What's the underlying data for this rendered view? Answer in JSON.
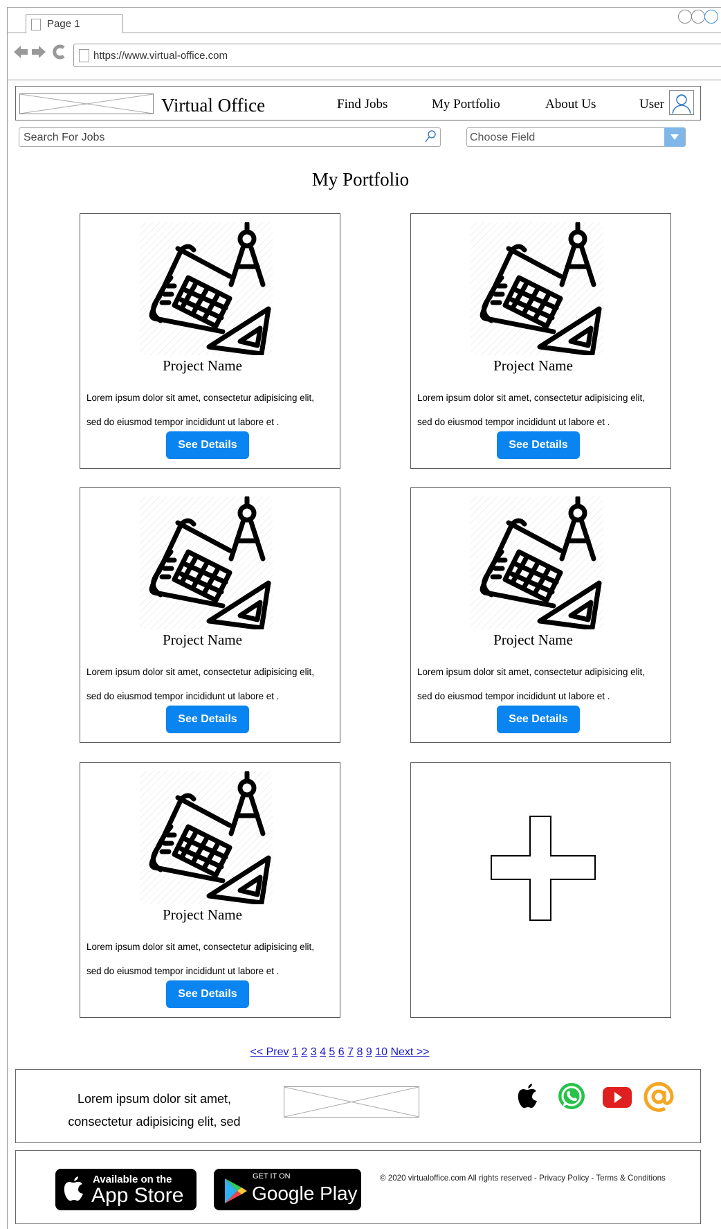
{
  "browser": {
    "tab_label": "Page 1",
    "url": "https://www.virtual-office.com"
  },
  "header": {
    "brand": "Virtual Office",
    "nav": [
      "Find Jobs",
      "My Portfolio",
      "About Us"
    ],
    "user_label": "User"
  },
  "search": {
    "placeholder": "Search For Jobs",
    "field_select": "Choose Field"
  },
  "page": {
    "title": "My Portfolio"
  },
  "projects": [
    {
      "name": "Project Name",
      "desc1": "Lorem ipsum dolor sit amet, consectetur adipisicing elit,",
      "desc2": "sed do eiusmod tempor incididunt ut labore et .",
      "button": "See Details"
    },
    {
      "name": "Project Name",
      "desc1": "Lorem ipsum dolor sit amet, consectetur adipisicing elit,",
      "desc2": "sed do eiusmod tempor incididunt ut labore et .",
      "button": "See Details"
    },
    {
      "name": "Project Name",
      "desc1": "Lorem ipsum dolor sit amet, consectetur adipisicing elit,",
      "desc2": "sed do eiusmod tempor incididunt ut labore et .",
      "button": "See Details"
    },
    {
      "name": "Project Name",
      "desc1": "Lorem ipsum dolor sit amet, consectetur adipisicing elit,",
      "desc2": "sed do eiusmod tempor incididunt ut labore et .",
      "button": "See Details"
    },
    {
      "name": "Project Name",
      "desc1": "Lorem ipsum dolor sit amet, consectetur adipisicing elit,",
      "desc2": "sed do eiusmod tempor incididunt ut labore et .",
      "button": "See Details"
    }
  ],
  "add_card_icon": "plus-icon",
  "pagination": {
    "prev": "<< Prev",
    "pages": [
      "1",
      "2",
      "3",
      "4",
      "5",
      "6",
      "7",
      "8",
      "9",
      "10"
    ],
    "next": "Next >>"
  },
  "footer": {
    "text1": "Lorem ipsum dolor sit amet,",
    "text2": "consectetur adipisicing elit, sed",
    "social_icons": [
      "apple-icon",
      "whatsapp-icon",
      "youtube-icon",
      "email-at-icon"
    ],
    "app_store_small": "Available on the",
    "app_store_big": "App Store",
    "google_play_small": "GET IT ON",
    "google_play_big": "Google Play",
    "copyright": "© 2020 virtualoffice.com All rights reserved -",
    "privacy": "Privacy Policy",
    "sep": "-",
    "terms": "Terms & Conditions"
  },
  "colors": {
    "button_blue": "#0a84f0",
    "link_blue": "#1a1ac8",
    "select_accent": "#7fb8e8",
    "youtube_red": "#e02020",
    "whatsapp_green": "#27c24a",
    "email_orange": "#f5a623"
  }
}
